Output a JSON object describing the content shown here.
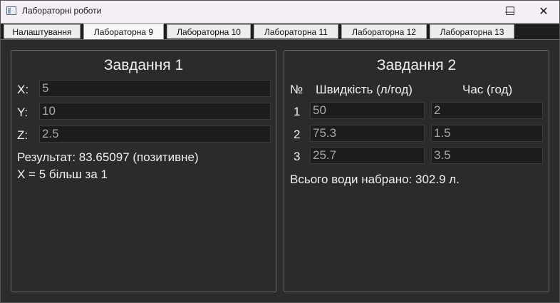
{
  "window": {
    "title": "Лабораторні роботи",
    "minimize_glyph": "—",
    "maximize_glyph": "☐",
    "close_glyph": "✕"
  },
  "tabs": [
    {
      "label": "Налаштування",
      "active": false
    },
    {
      "label": "Лабораторна 9",
      "active": true
    },
    {
      "label": "Лабораторна 10",
      "active": false
    },
    {
      "label": "Лабораторна 11",
      "active": false
    },
    {
      "label": "Лабораторна 12",
      "active": false
    },
    {
      "label": "Лабораторна 13",
      "active": false
    }
  ],
  "task1": {
    "title": "Завдання 1",
    "x_label": "X:",
    "x_value": "5",
    "y_label": "Y:",
    "y_value": "10",
    "z_label": "Z:",
    "z_value": "2.5",
    "result": "Результат: 83.65097 (позитивне)",
    "comparison": "X = 5 більш за 1"
  },
  "task2": {
    "title": "Завдання 2",
    "headers": {
      "num": "№",
      "speed": "Швидкість (л/год)",
      "time": "Час (год)"
    },
    "rows": [
      {
        "num": "1",
        "speed": "50",
        "time": "2"
      },
      {
        "num": "2",
        "speed": "75.3",
        "time": "1.5"
      },
      {
        "num": "3",
        "speed": "25.7",
        "time": "3.5"
      }
    ],
    "total": "Всього води набрано: 302.9 л."
  },
  "colors": {
    "background": "#2b2b2b",
    "field_bg": "#1c1c1c",
    "text": "#f0f0f0",
    "field_text": "#a8a8a8"
  }
}
